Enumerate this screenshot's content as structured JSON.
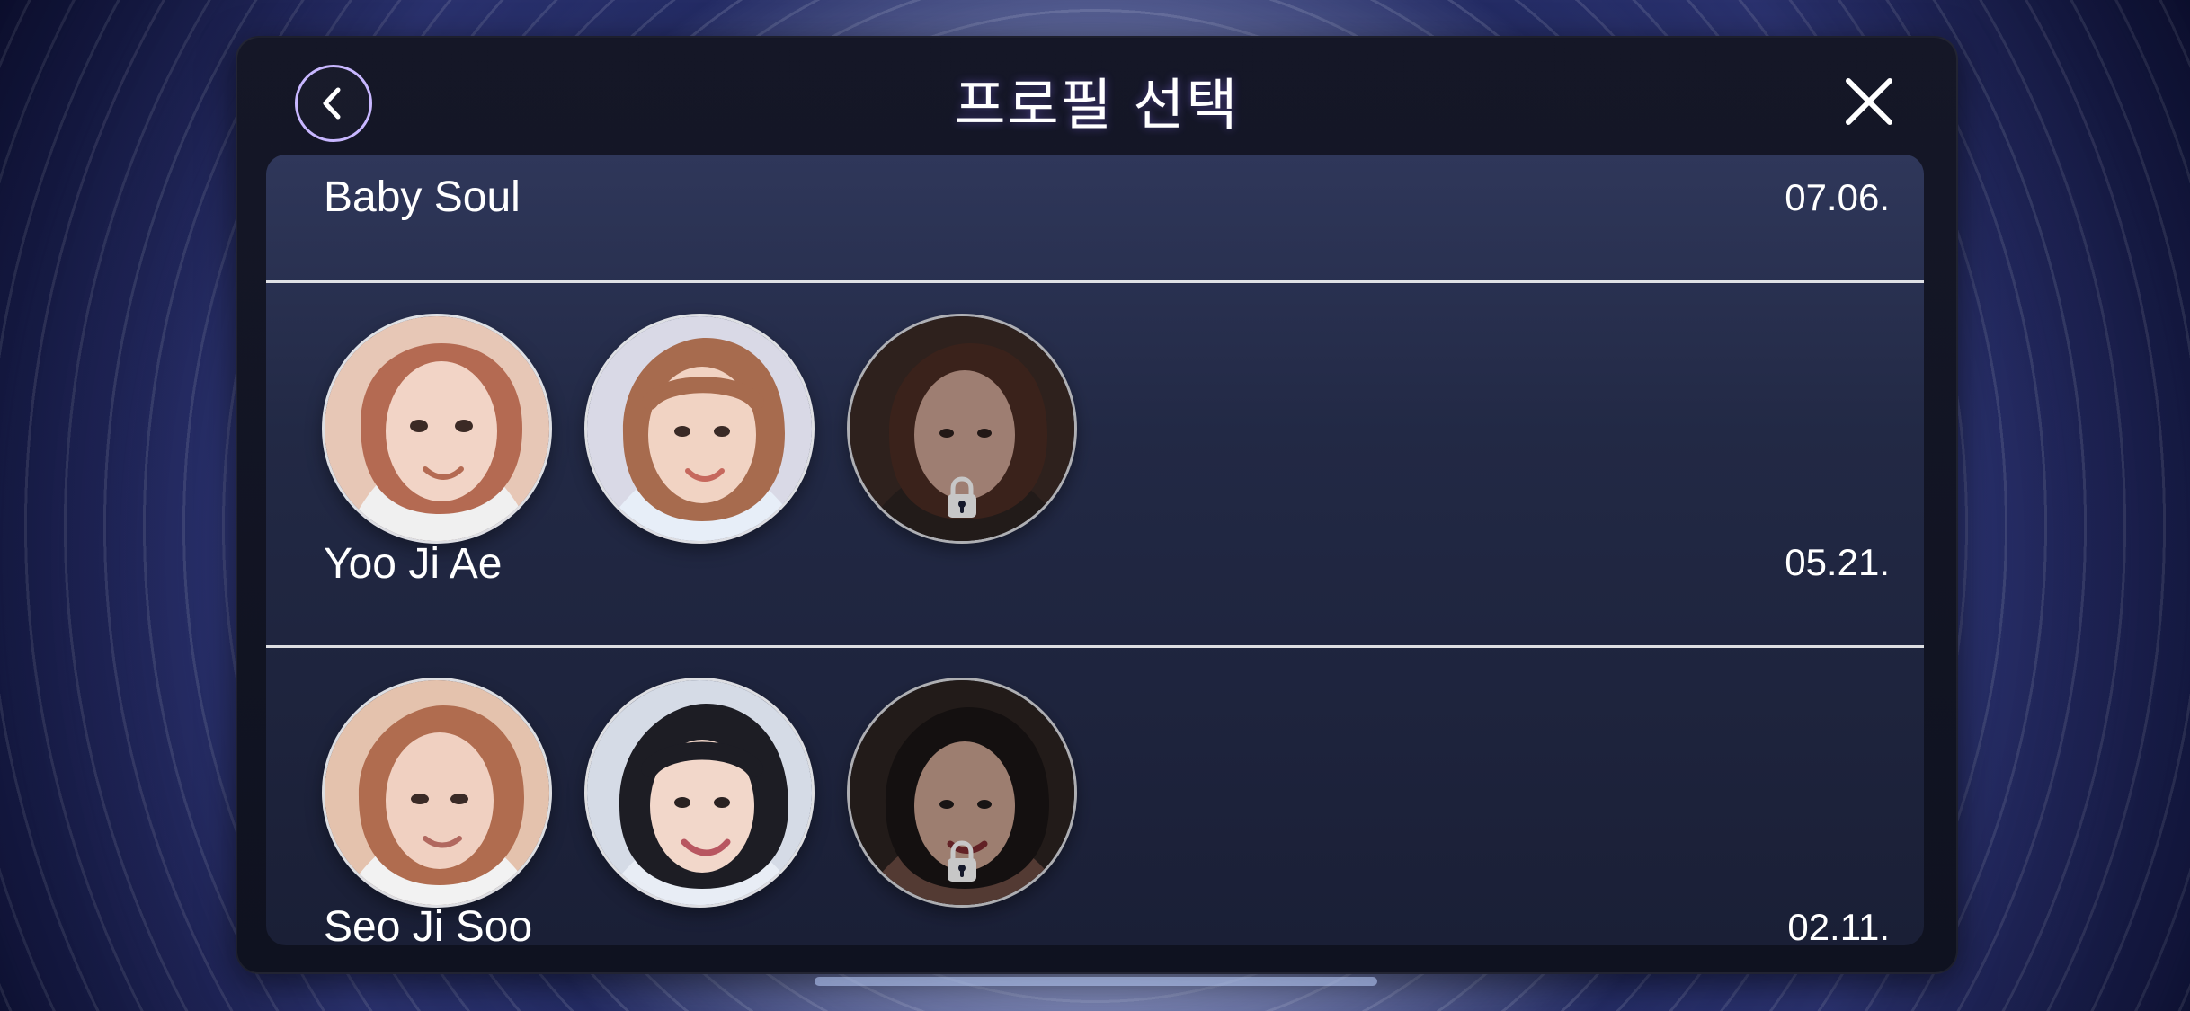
{
  "modal": {
    "title": "프로필 선택",
    "back_icon": "chevron-left-icon",
    "close_icon": "close-icon"
  },
  "groups": [
    {
      "name": "Baby Soul",
      "date": "07.06.",
      "profiles": [
        {
          "locked": false,
          "palette": {
            "bg": "#e7c7b6",
            "hair": "#b46a52",
            "skin": "#f2d4c6",
            "cloth": "#f0f0f0"
          }
        },
        {
          "locked": false,
          "palette": {
            "bg": "#d9d9e6",
            "hair": "#a76b4e",
            "skin": "#f1d3c3",
            "cloth": "#e7eef8"
          }
        },
        {
          "locked": true,
          "palette": {
            "bg": "#3b2a25",
            "hair": "#4b2b22",
            "skin": "#caa292",
            "cloth": "#2b2220"
          }
        }
      ]
    },
    {
      "name": "Yoo Ji Ae",
      "date": "05.21.",
      "profiles": [
        {
          "locked": false,
          "palette": {
            "bg": "#e4c2ad",
            "hair": "#b06c4f",
            "skin": "#f0d0c1",
            "cloth": "#f2f2f2"
          }
        },
        {
          "locked": false,
          "palette": {
            "bg": "#d5dbe6",
            "hair": "#1d1d24",
            "skin": "#f2d7ca",
            "cloth": "#e8edf5"
          }
        },
        {
          "locked": true,
          "palette": {
            "bg": "#2c2320",
            "hair": "#1a1514",
            "skin": "#c9a190",
            "cloth": "#6b4a42"
          }
        }
      ]
    },
    {
      "name": "Seo Ji Soo",
      "date": "02.11.",
      "profiles": []
    }
  ],
  "icons": {
    "lock": "lock-icon"
  }
}
